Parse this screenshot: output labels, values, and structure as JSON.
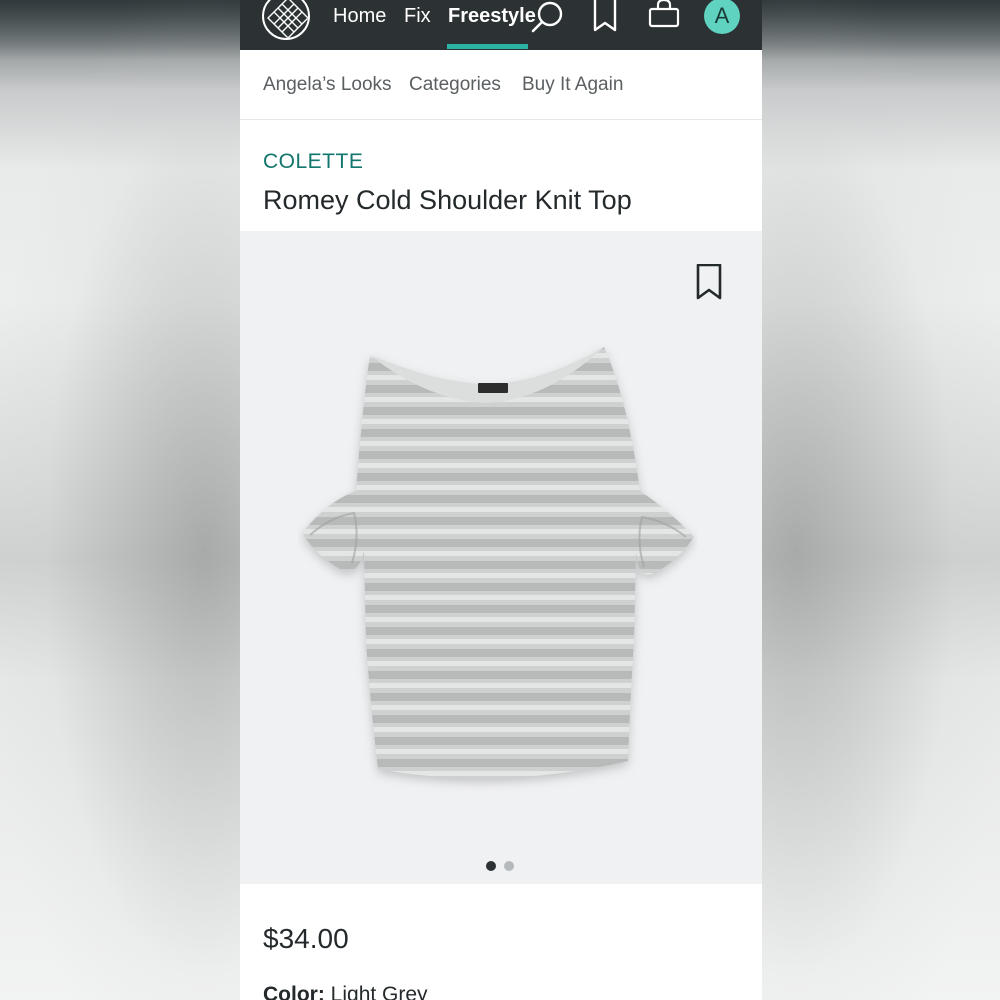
{
  "nav": {
    "links": [
      "Home",
      "Fix",
      "Freestyle"
    ],
    "active": "Freestyle",
    "avatar_initial": "A",
    "icons": [
      "logo-icon",
      "search-icon",
      "bookmark-icon",
      "bag-icon"
    ],
    "accent_color": "#2bb3a3"
  },
  "subnav": {
    "items": [
      "Angela’s Looks",
      "Categories",
      "Buy It Again"
    ]
  },
  "product": {
    "brand": "COLETTE",
    "name": "Romey Cold Shoulder Knit Top",
    "price": "$34.00",
    "color_label": "Color:",
    "color_value": "Light Grey",
    "image_description_icon": "striped-tee-image",
    "carousel": {
      "total": 2,
      "current": 1
    }
  },
  "colors": {
    "brand_text": "#11766b",
    "nav_bg": "#2c3133",
    "avatar_bg": "#5fd3c0"
  }
}
